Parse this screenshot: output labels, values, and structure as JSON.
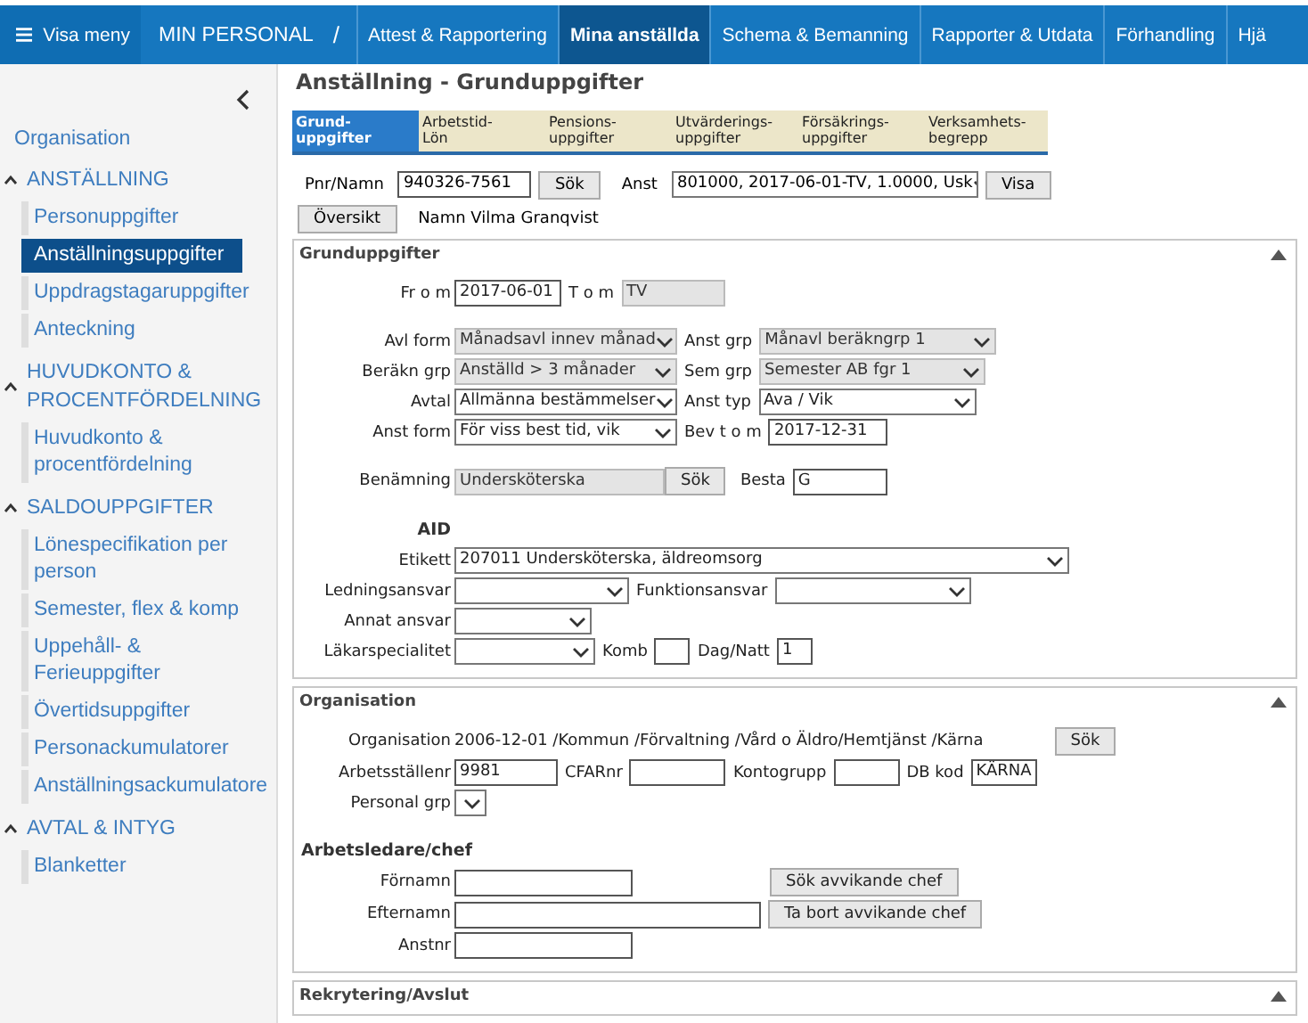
{
  "topbar": {
    "menu_button": "Visa meny",
    "app_title": "MIN PERSONAL",
    "separator": "/",
    "tabs": [
      {
        "label": "Attest & Rapportering",
        "selected": false
      },
      {
        "label": "Mina anställda",
        "selected": true
      },
      {
        "label": "Schema & Bemanning",
        "selected": false
      },
      {
        "label": "Rapporter & Utdata",
        "selected": false
      },
      {
        "label": "Förhandling",
        "selected": false
      },
      {
        "label": "Hjä",
        "selected": false
      }
    ]
  },
  "sidebar": {
    "items": [
      {
        "kind": "link",
        "label": "Organisation"
      },
      {
        "kind": "group",
        "label": "ANSTÄLLNING",
        "expanded": true,
        "children": [
          {
            "label": "Personuppgifter",
            "selected": false
          },
          {
            "label": "Anställningsuppgifter",
            "selected": true
          },
          {
            "label": "Uppdragstagaruppgifter",
            "selected": false
          },
          {
            "label": "Anteckning",
            "selected": false
          }
        ]
      },
      {
        "kind": "group",
        "label": "HUVUDKONTO & PROCENTFÖRDELNING",
        "expanded": true,
        "children": [
          {
            "label": "Huvudkonto & procentfördelning",
            "selected": false
          }
        ]
      },
      {
        "kind": "group",
        "label": "SALDOUPPGIFTER",
        "expanded": true,
        "children": [
          {
            "label": "Lönespecifikation per person",
            "selected": false
          },
          {
            "label": "Semester, flex & komp",
            "selected": false
          },
          {
            "label": "Uppehåll- & Ferieuppgifter",
            "selected": false
          },
          {
            "label": "Övertidsuppgifter",
            "selected": false
          },
          {
            "label": "Personackumulatorer",
            "selected": false
          },
          {
            "label": "Anställningsackumulatore",
            "selected": false
          }
        ]
      },
      {
        "kind": "group",
        "label": "AVTAL & INTYG",
        "expanded": true,
        "children": [
          {
            "label": "Blanketter",
            "selected": false
          }
        ]
      }
    ]
  },
  "page_title": "Anställning - Grunduppgifter",
  "tabs": [
    {
      "label": "Grund-\nuppgifter",
      "selected": true
    },
    {
      "label": "Arbetstid-\nLön",
      "selected": false
    },
    {
      "label": "Pensions-\nuppgifter",
      "selected": false
    },
    {
      "label": "Utvärderings-\nuppgifter",
      "selected": false
    },
    {
      "label": "Försäkrings-\nuppgifter",
      "selected": false
    },
    {
      "label": "Verksamhets-\nbegrepp",
      "selected": false
    }
  ],
  "lookup": [
    [
      {
        "kind": "label",
        "text": "Pnr/Namn"
      },
      {
        "kind": "input",
        "value": "940326-7561",
        "disabled": false
      },
      {
        "kind": "button",
        "label": "Sök"
      },
      {
        "kind": "label",
        "text": "Anst"
      },
      {
        "kind": "select",
        "value": "801000, 2017-06-01-TV, 1.0000, Usk",
        "disabled": false
      },
      {
        "kind": "button",
        "label": "Visa"
      }
    ],
    [
      {
        "kind": "button",
        "label": "Översikt"
      },
      {
        "kind": "label",
        "text": "Namn Vilma Granqvist"
      }
    ]
  ],
  "sections": [
    {
      "title": "Grunduppgifter",
      "expanded": true,
      "groups": [
        [
          {
            "label": "Fr o m",
            "items": [
              {
                "kind": "input",
                "value": "2017-06-01",
                "disabled": false
              },
              {
                "kind": "label",
                "text": "T o m"
              },
              {
                "kind": "input",
                "value": "TV",
                "disabled": true
              }
            ]
          }
        ],
        [
          {
            "label": "Avl form",
            "items": [
              {
                "kind": "select",
                "value": "Månadsavl innev månad",
                "disabled": true
              },
              {
                "kind": "label",
                "text": "Anst grp"
              },
              {
                "kind": "select",
                "value": "Månavl beräkngrp 1",
                "disabled": true
              }
            ]
          },
          {
            "label": "Beräkn grp",
            "items": [
              {
                "kind": "select",
                "value": "Anställd > 3 månader",
                "disabled": true
              },
              {
                "kind": "label",
                "text": "Sem grp"
              },
              {
                "kind": "select",
                "value": "Semester AB fgr 1",
                "disabled": true
              }
            ]
          },
          {
            "label": "Avtal",
            "items": [
              {
                "kind": "select",
                "value": "Allmänna bestämmelser",
                "disabled": false
              },
              {
                "kind": "label",
                "text": "Anst typ"
              },
              {
                "kind": "select",
                "value": "Ava / Vik",
                "disabled": false
              }
            ]
          },
          {
            "label": "Anst form",
            "items": [
              {
                "kind": "select",
                "value": "För viss best tid, vik",
                "disabled": false
              },
              {
                "kind": "label",
                "text": "Bev t o m"
              },
              {
                "kind": "input",
                "value": "2017-12-31",
                "disabled": false
              }
            ]
          }
        ],
        [
          {
            "label": "Benämning",
            "items": [
              {
                "kind": "input",
                "value": "Undersköterska",
                "disabled": true
              },
              {
                "kind": "button",
                "label": "Sök"
              },
              {
                "kind": "label",
                "text": "Besta"
              },
              {
                "kind": "input",
                "value": "G",
                "disabled": false
              }
            ]
          }
        ],
        [
          {
            "kind": "heading",
            "label": "AID"
          },
          {
            "label": "Etikett",
            "items": [
              {
                "kind": "select",
                "value": "207011 Undersköterska, äldreomsorg",
                "disabled": false
              }
            ]
          },
          {
            "label": "Ledningsansvar",
            "items": [
              {
                "kind": "select",
                "disabled": false
              },
              {
                "kind": "label",
                "text": "Funktionsansvar"
              },
              {
                "kind": "select",
                "disabled": false
              }
            ]
          },
          {
            "label": "Annat ansvar",
            "items": [
              {
                "kind": "select",
                "disabled": false
              }
            ]
          },
          {
            "label": "Läkarspecialitet",
            "items": [
              {
                "kind": "select",
                "disabled": false
              },
              {
                "kind": "label",
                "text": "Komb"
              },
              {
                "kind": "input",
                "disabled": false
              },
              {
                "kind": "label",
                "text": "Dag/Natt"
              },
              {
                "kind": "input",
                "value": "1",
                "disabled": false
              }
            ]
          }
        ]
      ]
    },
    {
      "title": "Organisation",
      "expanded": true,
      "groups": [
        [
          {
            "label": "Organisation",
            "items": [
              {
                "kind": "text",
                "text": "2006-12-01 /Kommun /Förvaltning /Vård o Äldro/Hemtjänst /Kärna"
              },
              {
                "kind": "button",
                "label": "Sök"
              }
            ]
          },
          {
            "label": "Arbetsställenr",
            "items": [
              {
                "kind": "input",
                "value": "9981",
                "disabled": false
              },
              {
                "kind": "label",
                "text": "CFARnr"
              },
              {
                "kind": "input",
                "disabled": false
              },
              {
                "kind": "label",
                "text": "Kontogrupp"
              },
              {
                "kind": "input",
                "disabled": false
              },
              {
                "kind": "label",
                "text": "DB kod"
              },
              {
                "kind": "input",
                "value": "KÄRNA",
                "disabled": false
              }
            ]
          },
          {
            "label": "Personal grp",
            "items": [
              {
                "kind": "select",
                "disabled": false
              }
            ]
          }
        ],
        [
          {
            "kind": "subheading",
            "label": "Arbetsledare/chef"
          },
          {
            "label": "Förnamn",
            "items": [
              {
                "kind": "input",
                "disabled": false
              },
              {
                "kind": "button",
                "label": "Sök avvikande chef"
              }
            ]
          },
          {
            "label": "Efternamn",
            "items": [
              {
                "kind": "input",
                "disabled": false
              },
              {
                "kind": "button",
                "label": "Ta bort avvikande chef"
              }
            ]
          },
          {
            "label": "Anstnr",
            "items": [
              {
                "kind": "input",
                "disabled": false
              }
            ]
          }
        ]
      ]
    },
    {
      "title": "Rekrytering/Avslut",
      "expanded": true
    }
  ]
}
